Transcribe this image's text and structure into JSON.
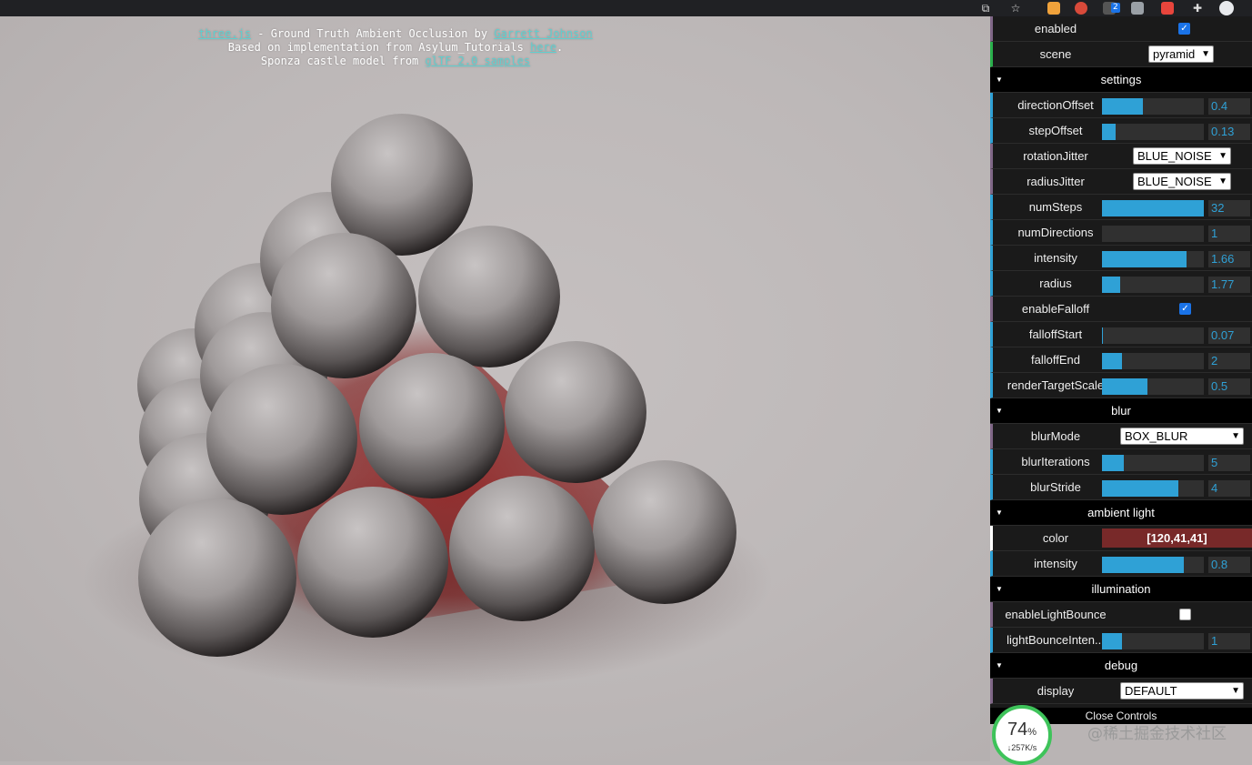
{
  "credits": {
    "line1_link": "three.js",
    "line1_text": " - Ground Truth Ambient Occlusion by ",
    "line1_author": "Garrett Johnson",
    "line2_text": "Based on implementation from Asylum_Tutorials ",
    "line2_link": "here",
    "line2_end": ".",
    "line3_text": "Sponza castle model from ",
    "line3_link": "glTF 2.0 samples"
  },
  "top": {
    "enabled_label": "enabled",
    "enabled_checked": true,
    "scene_label": "scene",
    "scene_value": "pyramid"
  },
  "settings": {
    "title": "settings",
    "directionOffset": {
      "label": "directionOffset",
      "value": "0.4",
      "fill": 0.4
    },
    "stepOffset": {
      "label": "stepOffset",
      "value": "0.13",
      "fill": 0.13
    },
    "rotationJitter": {
      "label": "rotationJitter",
      "value": "BLUE_NOISE"
    },
    "radiusJitter": {
      "label": "radiusJitter",
      "value": "BLUE_NOISE"
    },
    "numSteps": {
      "label": "numSteps",
      "value": "32",
      "fill": 1.0
    },
    "numDirections": {
      "label": "numDirections",
      "value": "1",
      "fill": 0.0
    },
    "intensity": {
      "label": "intensity",
      "value": "1.66",
      "fill": 0.83
    },
    "radius": {
      "label": "radius",
      "value": "1.77",
      "fill": 0.18
    },
    "enableFalloff": {
      "label": "enableFalloff",
      "checked": true
    },
    "falloffStart": {
      "label": "falloffStart",
      "value": "0.07",
      "fill": 0.01
    },
    "falloffEnd": {
      "label": "falloffEnd",
      "value": "2",
      "fill": 0.2
    },
    "renderTargetScale": {
      "label": "renderTargetScale",
      "value": "0.5",
      "fill": 0.45
    }
  },
  "blur": {
    "title": "blur",
    "blurMode": {
      "label": "blurMode",
      "value": "BOX_BLUR"
    },
    "blurIterations": {
      "label": "blurIterations",
      "value": "5",
      "fill": 0.21
    },
    "blurStride": {
      "label": "blurStride",
      "value": "4",
      "fill": 0.75
    }
  },
  "ambient": {
    "title": "ambient light",
    "color": {
      "label": "color",
      "value": "[120,41,41]",
      "hex": "#782929"
    },
    "intensity": {
      "label": "intensity",
      "value": "0.8",
      "fill": 0.8
    }
  },
  "illumination": {
    "title": "illumination",
    "enableLightBounce": {
      "label": "enableLightBounce",
      "checked": false
    },
    "lightBounceIntensity": {
      "label": "lightBounceInten...",
      "value": "1",
      "fill": 0.2
    }
  },
  "debug": {
    "title": "debug",
    "display": {
      "label": "display",
      "value": "DEFAULT"
    }
  },
  "close_label": "Close Controls",
  "perf": {
    "percent": "74",
    "percent_sign": "%",
    "speed": "257K/s"
  },
  "watermark": "@稀土掘金技术社区",
  "colors": {
    "accent": "#2fa1d6",
    "panel": "#1a1a1a",
    "ambient": "#782929",
    "badge": "#3ec35a"
  },
  "browser": {
    "badge_count": "2"
  }
}
